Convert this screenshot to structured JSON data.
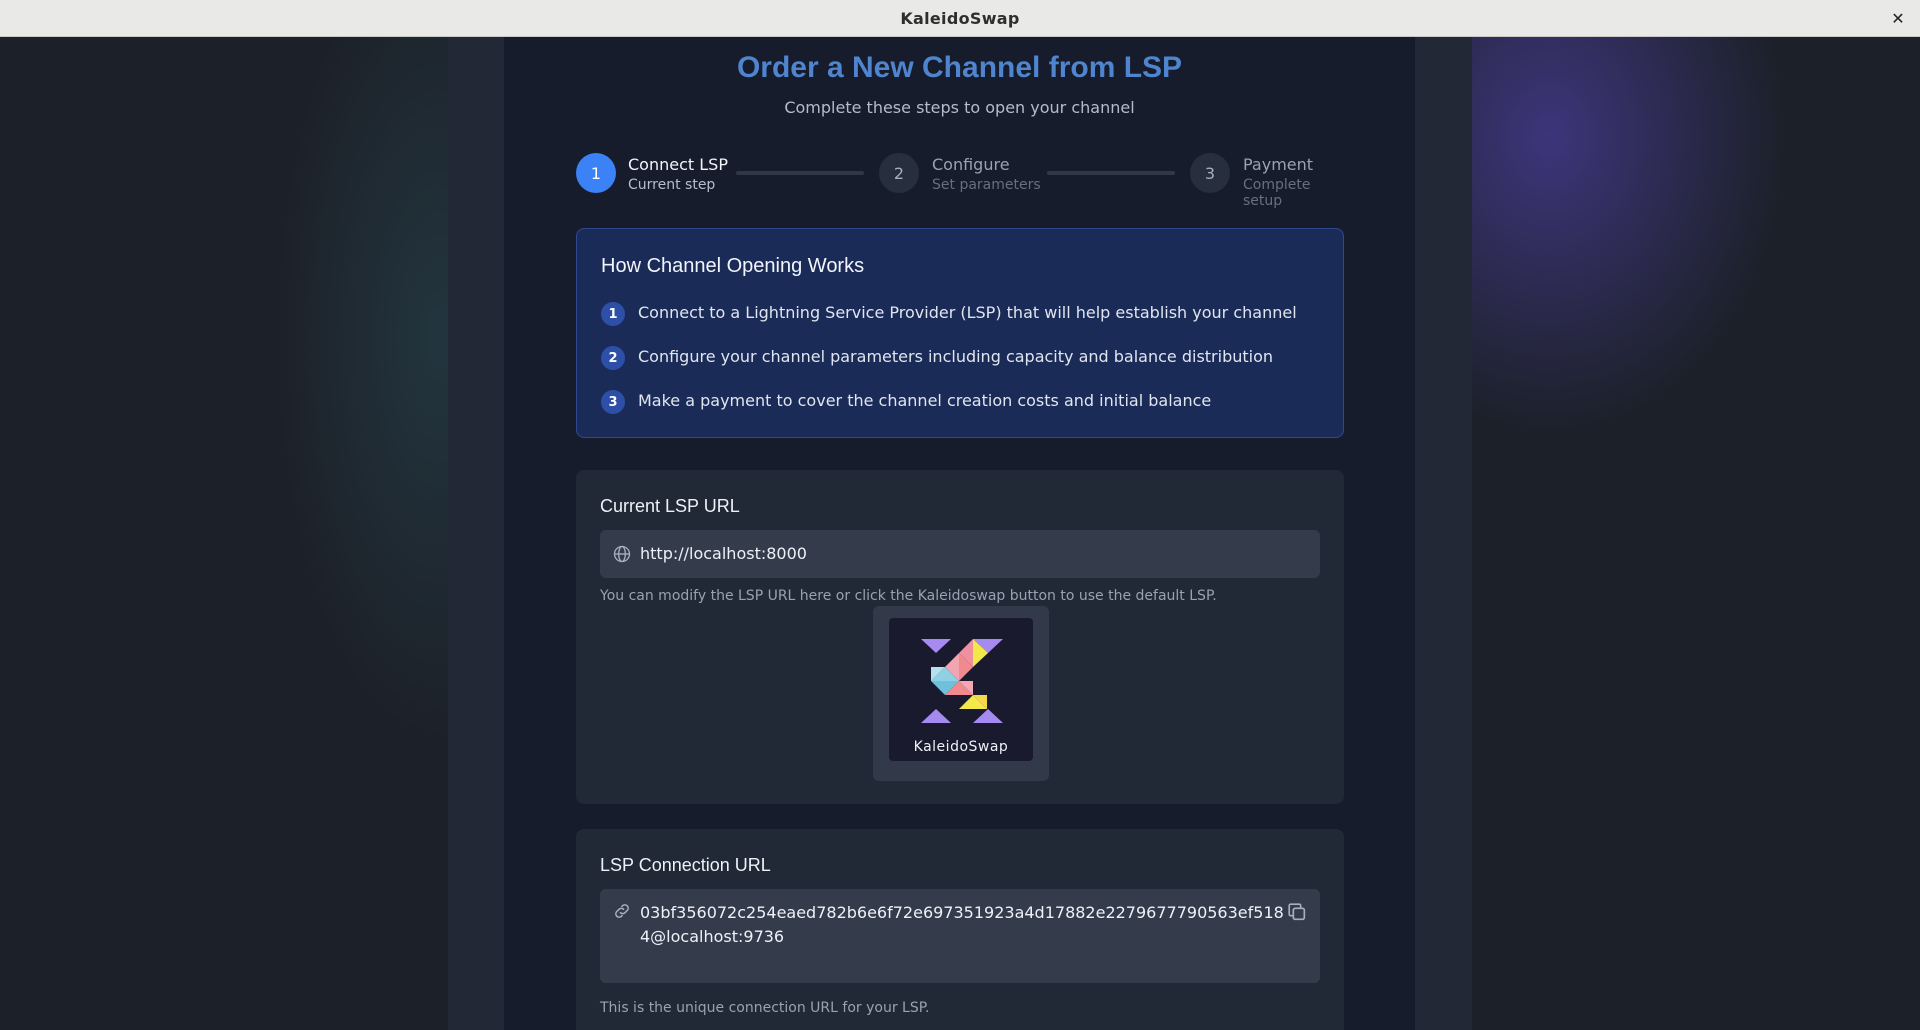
{
  "window": {
    "title": "KaleidoSwap",
    "close_glyph": "✕"
  },
  "page": {
    "heading": "Order a New Channel from LSP",
    "subheading": "Complete these steps to open your channel"
  },
  "stepper": {
    "steps": [
      {
        "number": "1",
        "label": "Connect LSP",
        "sub": "Current step",
        "state": "active"
      },
      {
        "number": "2",
        "label": "Configure",
        "sub": "Set parameters",
        "state": "inactive"
      },
      {
        "number": "3",
        "label": "Payment",
        "sub": "Complete setup",
        "state": "inactive"
      }
    ]
  },
  "info": {
    "title": "How Channel Opening Works",
    "items": [
      {
        "number": "1",
        "text": "Connect to a Lightning Service Provider (LSP) that will help establish your channel"
      },
      {
        "number": "2",
        "text": "Configure your channel parameters including capacity and balance distribution"
      },
      {
        "number": "3",
        "text": "Make a payment to cover the channel creation costs and initial balance"
      }
    ]
  },
  "lsp_url": {
    "title": "Current LSP URL",
    "value": "http://localhost:8000",
    "icon": "globe-icon",
    "hint": "You can modify the LSP URL here or click the Kaleidoswap button to use the default LSP.",
    "button_label": "KaleidoSwap"
  },
  "connection": {
    "title": "LSP Connection URL",
    "icon": "link-icon",
    "value_line1": "03bf356072c254eaed782b6e6f72e697351923a4d17882e2279677790563ef518",
    "value_line2": "4@localhost:9736",
    "copy_icon": "copy-icon",
    "hint": "This is the unique connection URL for your LSP."
  },
  "colors": {
    "accent": "#3b82f6",
    "heading": "#4f84cf",
    "info_bg": "#1b2b58",
    "card_bg": "#212937",
    "panel_bg": "#161c2b"
  }
}
